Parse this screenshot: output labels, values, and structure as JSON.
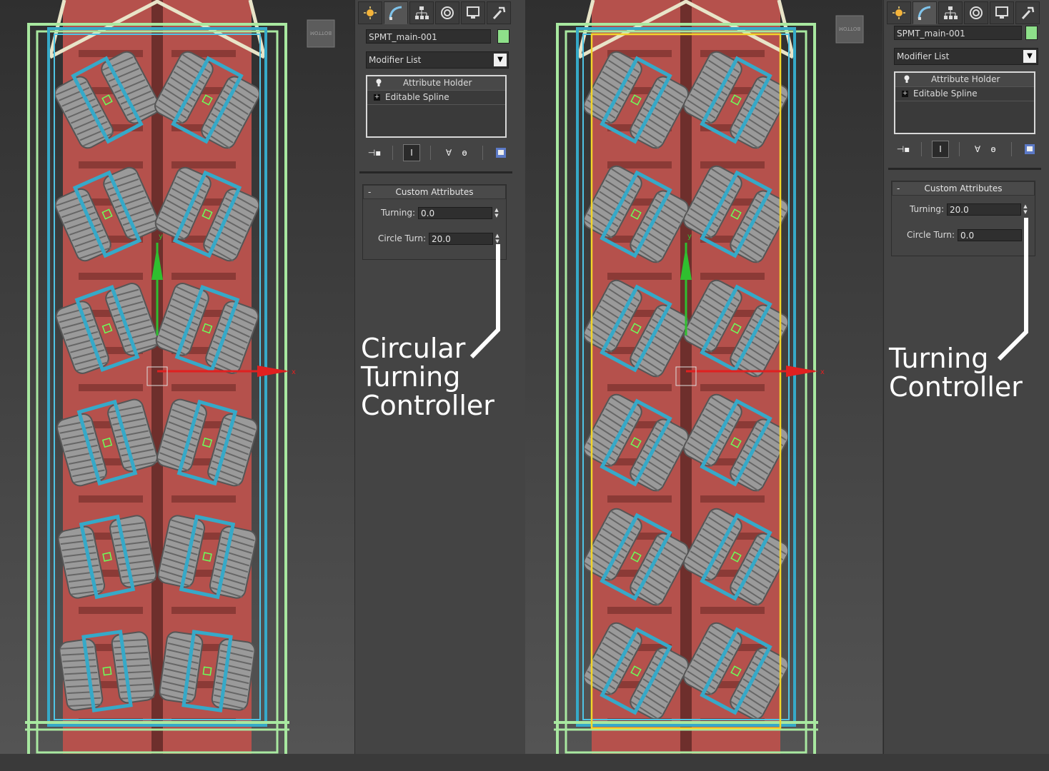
{
  "left": {
    "panel": {
      "object_name": "SPMT_main-001",
      "modifier_list": "Modifier List",
      "stack": [
        "Attribute Holder",
        "Editable Spline"
      ],
      "rollout_title": "Custom Attributes",
      "params": [
        {
          "label": "Turning:",
          "value": "0.0"
        },
        {
          "label": "Circle Turn:",
          "value": "20.0"
        }
      ]
    },
    "annotation": "Circular\nTurning\nController"
  },
  "right": {
    "panel": {
      "object_name": "SPMT_main-001",
      "modifier_list": "Modifier List",
      "stack": [
        "Attribute Holder",
        "Editable Spline"
      ],
      "rollout_title": "Custom Attributes",
      "params": [
        {
          "label": "Turning:",
          "value": "20.0"
        },
        {
          "label": "Circle Turn:",
          "value": "0.0"
        }
      ]
    },
    "annotation": "Turning\nController"
  },
  "viewport": {
    "viewcube_label": "BOTTOM",
    "axis_x": "x",
    "axis_y": "y"
  },
  "colors": {
    "wire_green": "#a8e8a0",
    "wire_cyan": "#36a9c8",
    "body_red": "#b5514c",
    "selection_yellow": "#f2d52a",
    "swatch": "#8ee08a"
  },
  "icons": [
    "create-icon",
    "modify-icon",
    "hierarchy-icon",
    "motion-icon",
    "display-icon",
    "utilities-icon",
    "pin-stack-icon",
    "show-end-result-icon",
    "make-unique-icon",
    "remove-modifier-icon",
    "configure-sets-icon"
  ]
}
